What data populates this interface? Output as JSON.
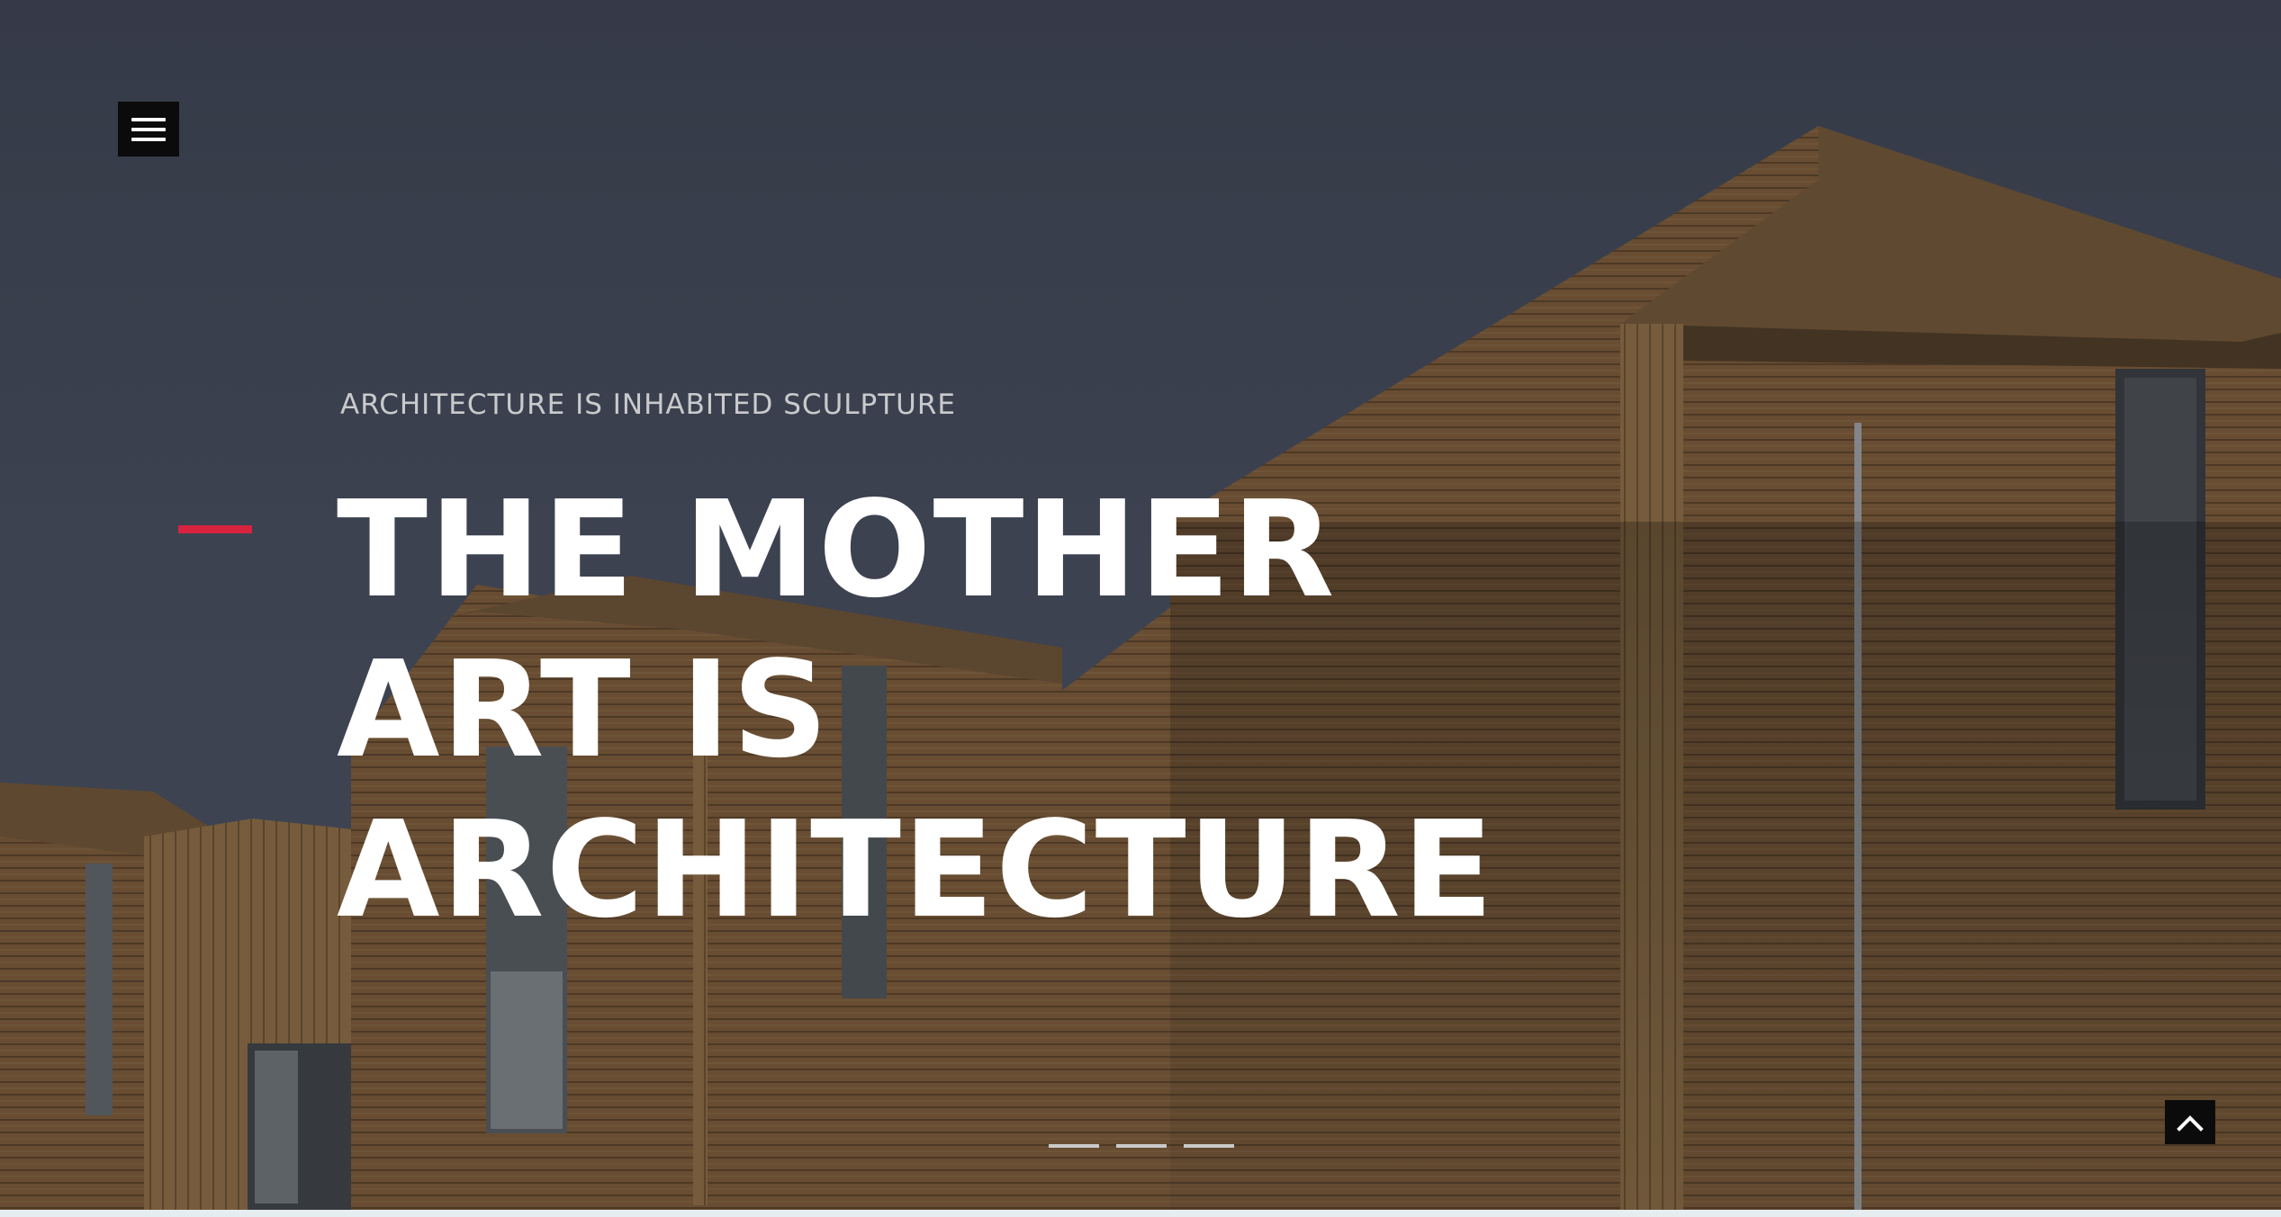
{
  "hero": {
    "tagline": "ARCHITECTURE IS INHABITED SCULPTURE",
    "headline_lines": [
      "THE MOTHER",
      "ART IS",
      "ARCHITECTURE"
    ],
    "accent_color": "#d8233f",
    "background_image": "wooden-houses-photo"
  },
  "nav": {
    "menu_icon": "hamburger-icon"
  },
  "slider": {
    "slide_count": 3,
    "active_index": 0
  },
  "scroll_top": {
    "icon": "chevron-up-icon"
  }
}
